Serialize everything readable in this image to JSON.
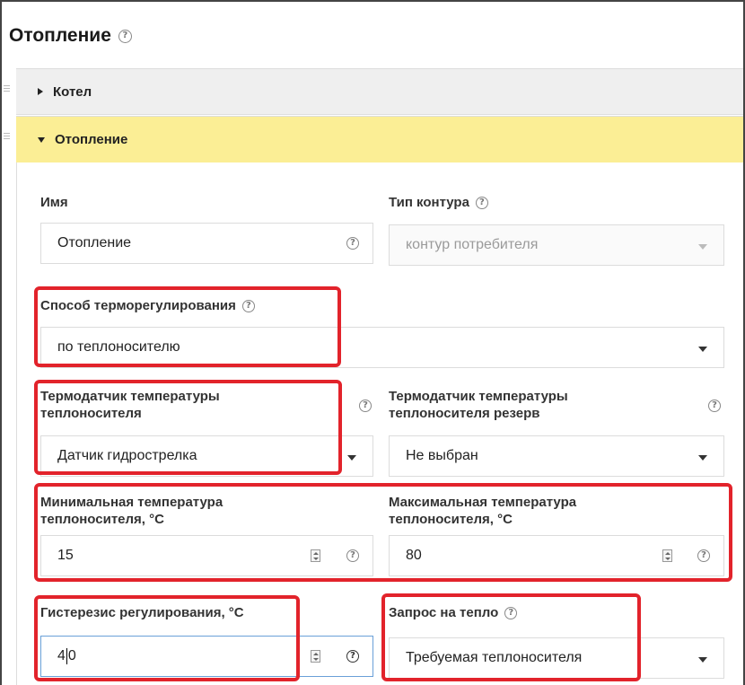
{
  "title": "Отопление",
  "panels": {
    "collapsed": {
      "label": "Котел"
    },
    "open": {
      "label": "Отопление"
    }
  },
  "form": {
    "name": {
      "label": "Имя",
      "value": "Отопление"
    },
    "circuit_type": {
      "label": "Тип контура",
      "value": "контур потребителя"
    },
    "regulation_method": {
      "label": "Способ терморегулирования",
      "value": "по теплоносителю"
    },
    "sensor": {
      "label_line1": "Термодатчик температуры",
      "label_line2": "теплоносителя",
      "value": "Датчик гидрострелка"
    },
    "sensor_reserve": {
      "label_line1": "Термодатчик температуры",
      "label_line2": "теплоносителя резерв",
      "value": "Не выбран"
    },
    "min_temp": {
      "label_line1": "Минимальная температура",
      "label_line2": "теплоносителя, °C",
      "value": "15"
    },
    "max_temp": {
      "label_line1": "Максимальная температура",
      "label_line2": "теплоносителя, °C",
      "value": "80"
    },
    "hysteresis": {
      "label": "Гистерезис регулирования, °C",
      "value_before_cursor": "4",
      "value_after_cursor": "0"
    },
    "heat_request": {
      "label": "Запрос на тепло",
      "value": "Требуемая теплоносителя"
    }
  },
  "icons": {
    "help": "?",
    "accent_red": "#e2232b",
    "panel_open_bg": "#fbee95"
  }
}
